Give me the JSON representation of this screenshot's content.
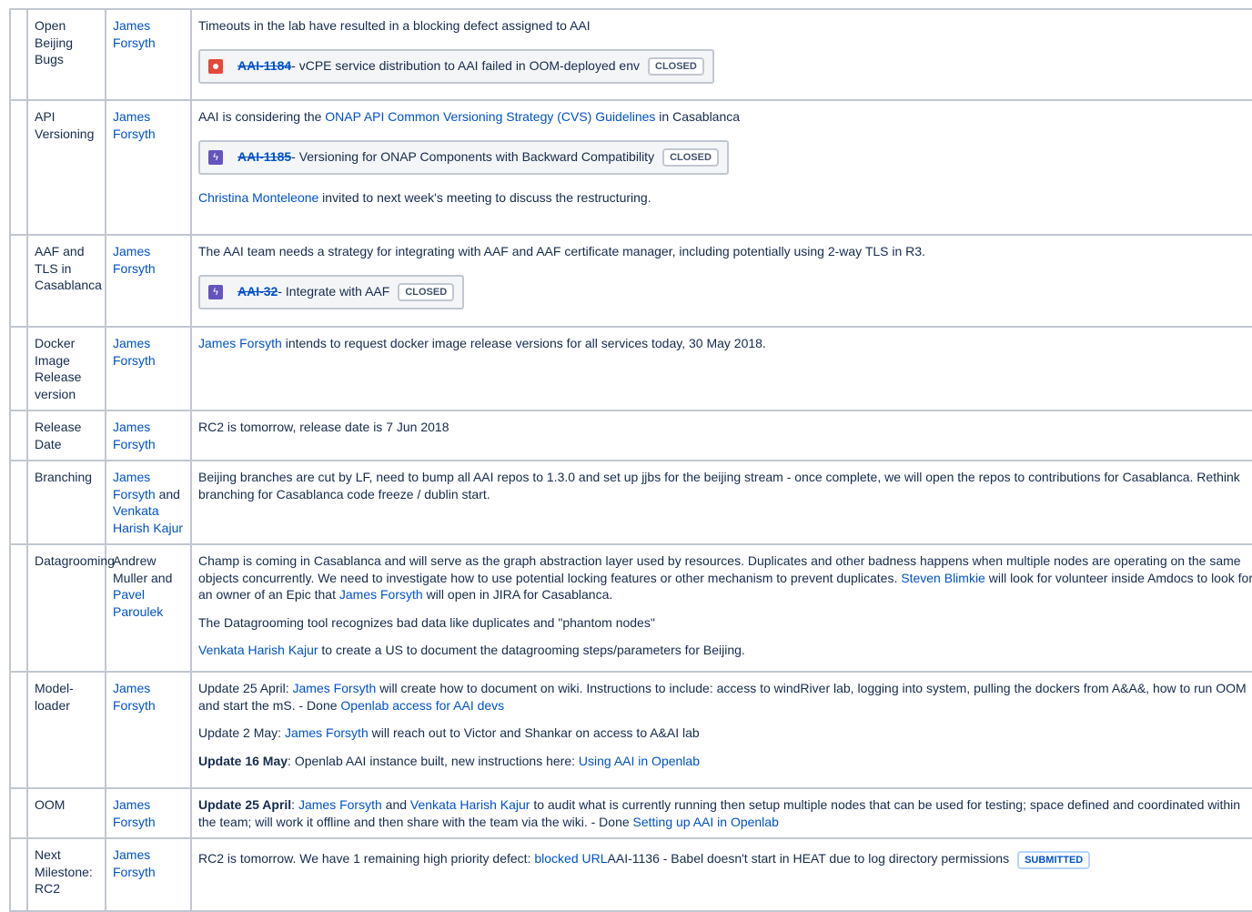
{
  "rows": [
    {
      "topic": "Open Beijing Bugs",
      "owner": "James Forsyth",
      "text": "Timeouts in the lab have resulted in a blocking defect assigned to AAI",
      "jira": {
        "key": "AAI-1184",
        "summary": " - vCPE service distribution to AAI failed in OOM-deployed env",
        "status": "CLOSED",
        "type_icon": "bug-icon"
      }
    },
    {
      "topic": "API Versioning",
      "owner": "James Forsyth",
      "text_a": "AAI is considering the ",
      "link": "ONAP API Common Versioning Strategy (CVS) Guidelines",
      "text_b": " in Casablanca",
      "jira": {
        "key": "AAI-1185",
        "summary": " - Versioning for ONAP Components with Backward Compatibility",
        "status": "CLOSED",
        "type_icon": "epic-icon"
      },
      "note_link": "Christina Monteleone",
      "note_text": " invited to next week's meeting to discuss the restructuring."
    },
    {
      "topic": "AAF and TLS in Casablanca",
      "owner": "James Forsyth",
      "text": "The AAI team needs a strategy for integrating with AAF and AAF certificate manager, including potentially using 2-way TLS in R3.",
      "jira": {
        "key": "AAI-32",
        "summary": " - Integrate with AAF",
        "status": "CLOSED",
        "type_icon": "epic-icon"
      }
    },
    {
      "topic": "Docker Image Release version",
      "owner": "James Forsyth",
      "link": "James Forsyth",
      "text": " intends to request docker image release versions for all services today, 30 May 2018."
    },
    {
      "topic": "Release Date",
      "owner": "James Forsyth",
      "text": "RC2 is tomorrow, release date is 7 Jun 2018"
    },
    {
      "topic": "Branching",
      "owner_a": "James Forsyth",
      "owner_and": " and ",
      "owner_b": "Venkata Harish Kajur",
      "text": "Beijing branches are cut by LF, need to bump all AAI repos to 1.3.0 and set up jjbs for the beijing stream - once complete, we will open the repos to contributions for Casablanca. Rethink branching for Casablanca code freeze / dublin start."
    },
    {
      "topic": "Datagrooming",
      "owner_text": "Andrew Muller and ",
      "owner_link": "Pavel Paroulek",
      "p1_a": "Champ is coming in Casablanca and will serve as the graph abstraction layer used by resources. Duplicates and other badness happens when multiple nodes are operating on the same objects concurrently. We need to investigate how to use potential locking features or other mechanism to prevent duplicates. ",
      "p1_link1": "Steven Blimkie",
      "p1_b": " will look for volunteer inside Amdocs to look for an owner of an Epic that ",
      "p1_link2": "James Forsyth",
      "p1_c": " will open in JIRA for Casablanca.",
      "p2": "The Datagrooming tool recognizes bad data like duplicates and \"phantom nodes\"",
      "p3_link": "Venkata Harish Kajur",
      "p3_text": " to create a US to document the datagrooming steps/parameters for Beijing."
    },
    {
      "topic": "Model-loader",
      "owner": "James Forsyth",
      "p1_a": "Update 25 April: ",
      "p1_link": "James Forsyth",
      "p1_b": " will create how to document on wiki.  Instructions to include: access to windRiver lab, logging into system, pulling the dockers from A&A&, how to run OOM and start the mS. - Done ",
      "p1_link2": "Openlab access for AAI devs",
      "p2_a": "Update 2 May: ",
      "p2_link": "James Forsyth",
      "p2_b": " will reach out to Victor and Shankar on access to A&AI lab",
      "p3_bold": "Update 16 May",
      "p3_a": ": Openlab AAI instance built, new instructions here: ",
      "p3_link": "Using AAI in Openlab"
    },
    {
      "topic": "OOM",
      "owner": "James Forsyth",
      "bold": "Update 25 April",
      "a": ": ",
      "link1": "James Forsyth",
      "b": " and ",
      "link2": "Venkata Harish Kajur",
      "c": " to audit what is currently running then setup multiple nodes that can be used for testing; space defined and coordinated within the team; will work it offline and then share with the team via the wiki. - Done ",
      "link3": "Setting up AAI in Openlab"
    },
    {
      "topic": "Next Milestone: RC2",
      "owner": "James Forsyth",
      "a": "RC2 is tomorrow. We have 1 remaining high priority defect: ",
      "link": "blocked URL",
      "b": "AAI-1136 - Babel doesn't start in HEAT due to log directory permissions",
      "status": "SUBMITTED"
    }
  ]
}
